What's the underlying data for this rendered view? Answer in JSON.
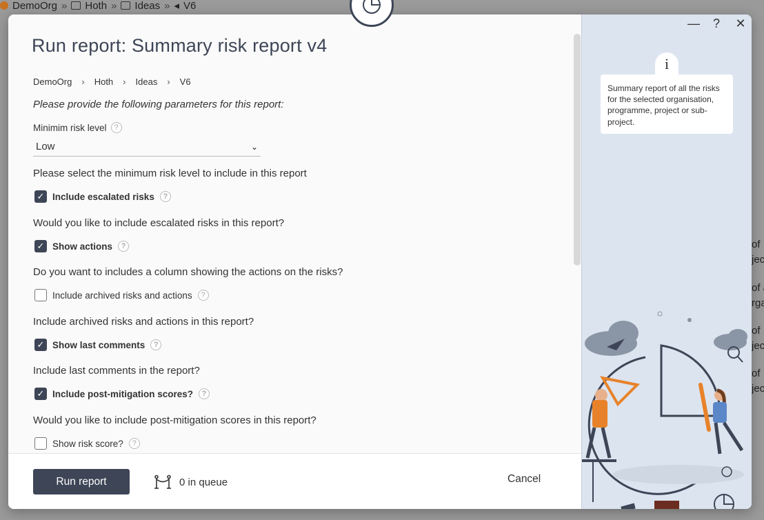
{
  "background": {
    "breadcrumb": [
      "DemoOrg",
      "Hoth",
      "Ideas",
      "V6"
    ],
    "right_fragments": [
      "of",
      "jec",
      "of a",
      "rga",
      "of",
      "jec",
      "of",
      "jec"
    ]
  },
  "modal": {
    "title": "Run report: Summary risk report v4",
    "breadcrumb": [
      "DemoOrg",
      "Hoth",
      "Ideas",
      "V6"
    ],
    "instructions": "Please provide the following parameters for this report:",
    "min_risk": {
      "label": "Minimim risk level",
      "value": "Low",
      "description": "Please select the minimum risk level to include in this report"
    },
    "options": [
      {
        "label": "Include escalated risks",
        "checked": true,
        "description": "Would you like to include escalated risks in this report?"
      },
      {
        "label": "Show actions",
        "checked": true,
        "description": "Do you want to includes a column showing the actions on the risks?"
      },
      {
        "label": "Include archived risks and actions",
        "checked": false,
        "description": "Include archived risks and actions in this report?"
      },
      {
        "label": "Show last comments",
        "checked": true,
        "description": "Include last comments in the report?"
      },
      {
        "label": "Include post-mitigation scores?",
        "checked": true,
        "description": "Would you like to include post-mitigation scores in this report?"
      },
      {
        "label": "Show risk score?",
        "checked": false,
        "description": ""
      }
    ],
    "footer": {
      "run_label": "Run report",
      "queue_text": "0 in queue",
      "cancel_label": "Cancel"
    },
    "side": {
      "info_icon": "i",
      "info_text": "Summary report of all the risks for the selected organisation, programme, project or sub-project.",
      "minimize": "—",
      "help": "?",
      "close": "✕"
    }
  },
  "colors": {
    "accent": "#3d4556",
    "side_bg": "#dce4ef"
  }
}
